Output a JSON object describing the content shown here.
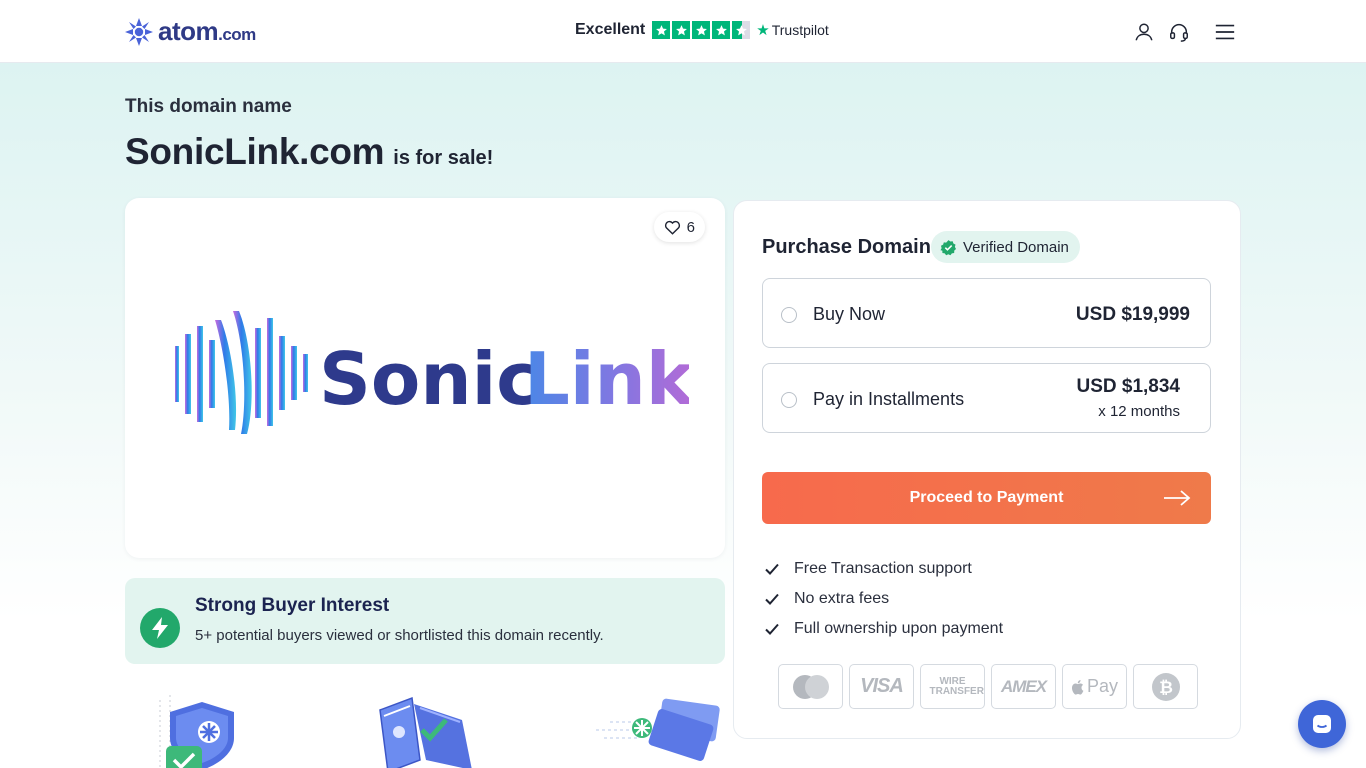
{
  "header": {
    "logo_text": "atom",
    "logo_suffix": ".com",
    "trust_label": "Excellent",
    "trustpilot_label": "Trustpilot",
    "trust_rating_stars": 4.5,
    "icons": [
      "user-icon",
      "headset-icon",
      "menu-icon"
    ]
  },
  "headline": {
    "kicker": "This domain name",
    "domain": "SonicLink.com",
    "suffix": "is for sale!"
  },
  "logo_card": {
    "likes": "6",
    "brand_word_a": "Sonic",
    "brand_word_b": "Link"
  },
  "interest": {
    "title": "Strong Buyer Interest",
    "text": "5+ potential buyers viewed or shortlisted this domain recently."
  },
  "purchase": {
    "title": "Purchase Domain",
    "verified_label": "Verified Domain",
    "options": [
      {
        "label": "Buy Now",
        "price": "USD $19,999",
        "sub": ""
      },
      {
        "label": "Pay in Installments",
        "price": "USD $1,834",
        "sub": "x 12 months"
      }
    ],
    "cta": "Proceed to Payment",
    "bullets": [
      "Free Transaction support",
      "No extra fees",
      "Full ownership upon payment"
    ],
    "payment_methods": [
      "mastercard-icon",
      "visa-icon",
      "wire-transfer-icon",
      "amex-icon",
      "apple-pay-icon",
      "bitcoin-icon"
    ],
    "payment_labels": {
      "visa": "VISA",
      "wire": "WIRE TRANSFER",
      "amex": "AMEX",
      "applepay": "Pay"
    }
  },
  "colors": {
    "accent_orange": "#f76a4c",
    "brand_navy": "#2f3a86",
    "success_green": "#22a86b",
    "trustpilot_green": "#00b67a",
    "chat_blue": "#3f66d8"
  }
}
